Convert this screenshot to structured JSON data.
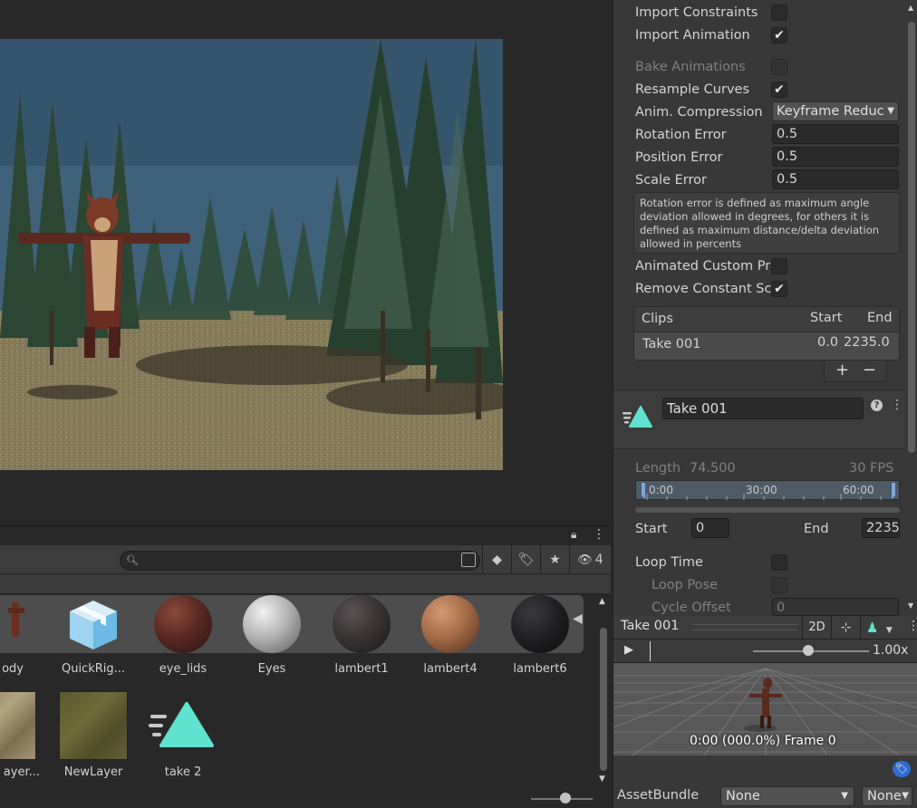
{
  "project": {
    "hidden_count": "4",
    "assets_top": [
      {
        "label": "ody",
        "kind": "model-partial"
      },
      {
        "label": "QuickRig...",
        "kind": "prefab"
      },
      {
        "label": "eye_lids",
        "color": "#5a2a22"
      },
      {
        "label": "Eyes",
        "color": "#b4b4b4"
      },
      {
        "label": "lambert1",
        "color": "#3a3435"
      },
      {
        "label": "lambert4",
        "color": "#a56c48"
      },
      {
        "label": "lambert6",
        "color": "#1f1f21"
      }
    ],
    "assets_bottom": [
      {
        "label": "ayer...",
        "kind": "terrain-texture"
      },
      {
        "label": "NewLayer",
        "kind": "terrain-layer"
      },
      {
        "label": "take 2",
        "kind": "animation-clip"
      }
    ]
  },
  "inspector": {
    "import_constraints": "Import Constraints",
    "import_animation": "Import Animation",
    "bake_animations": "Bake Animations",
    "resample_curves": "Resample Curves",
    "anim_compression": "Anim. Compression",
    "anim_compression_value": "Keyframe Reduc",
    "rotation_error": "Rotation Error",
    "rotation_error_value": "0.5",
    "position_error": "Position Error",
    "position_error_value": "0.5",
    "scale_error": "Scale Error",
    "scale_error_value": "0.5",
    "help_text": "Rotation error is defined as maximum angle deviation allowed in degrees, for others it is defined as maximum distance/delta deviation allowed in percents",
    "animated_custom": "Animated Custom Pr",
    "remove_constant": "Remove Constant Sc",
    "clips": {
      "col_clips": "Clips",
      "col_start": "Start",
      "col_end": "End",
      "row_name": "Take 001",
      "row_start": "0.0",
      "row_end": "2235.0",
      "add": "+",
      "remove": "−"
    },
    "clip_name": "Take 001",
    "length_label": "Length",
    "length_value": "74.500",
    "fps": "30 FPS",
    "ticks": [
      "0:00",
      "30:00",
      "60:00"
    ],
    "start_label": "Start",
    "start_value": "0",
    "end_label": "End",
    "end_value": "2235",
    "loop_time": "Loop Time",
    "loop_pose": "Loop Pose",
    "cycle_offset": "Cycle Offset",
    "cycle_offset_value": "0"
  },
  "preview": {
    "title": "Take 001",
    "mode_2d": "2D",
    "speed": "1.00x",
    "frame_info": "0:00 (000.0%) Frame 0",
    "assetbundle_label": "AssetBundle",
    "assetbundle_value": "None",
    "variant_value": "None"
  }
}
